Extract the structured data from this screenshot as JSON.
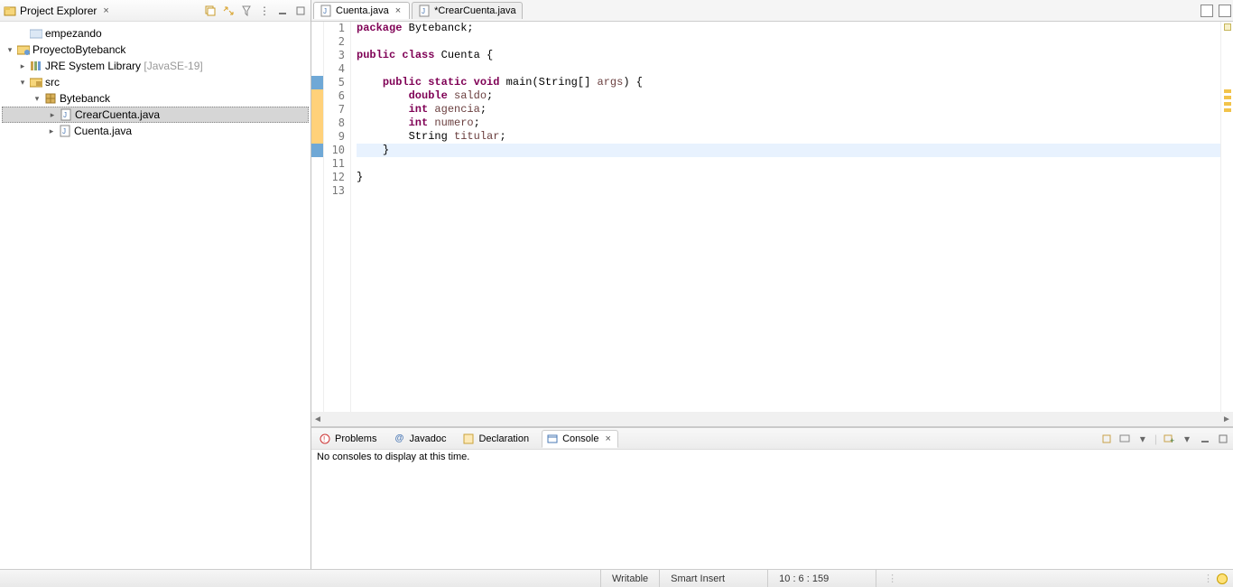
{
  "project_explorer": {
    "title": "Project Explorer",
    "tree": {
      "empezando": "empezando",
      "proyecto": "ProyectoBytebanck",
      "jre": "JRE System Library",
      "jre_qualifier": "[JavaSE-19]",
      "src": "src",
      "pkg": "Bytebanck",
      "crear": "CrearCuenta.java",
      "cuenta": "Cuenta.java"
    }
  },
  "editor": {
    "tabs": {
      "active": "Cuenta.java",
      "second": "*CrearCuenta.java"
    },
    "code": {
      "l1_kw": "package",
      "l1_rest": " Bytebanck;",
      "l3a": "public",
      "l3b": "class",
      "l3c": " Cuenta {",
      "l5a": "public",
      "l5b": "static",
      "l5c": "void",
      "l5d": " main(String[] ",
      "l5e": "args",
      "l5f": ") {",
      "l6a": "double",
      "l6b": "saldo",
      "l6c": ";",
      "l7a": "int",
      "l7b": "agencia",
      "l7c": ";",
      "l8a": "int",
      "l8b": "numero",
      "l8c": ";",
      "l9a": "String ",
      "l9b": "titular",
      "l9c": ";",
      "l10": "}",
      "l12": "}"
    },
    "lines": [
      "1",
      "2",
      "3",
      "4",
      "5",
      "6",
      "7",
      "8",
      "9",
      "10",
      "11",
      "12",
      "13"
    ]
  },
  "bottom": {
    "problems": "Problems",
    "javadoc": "Javadoc",
    "declaration": "Declaration",
    "console": "Console",
    "msg": "No consoles to display at this time."
  },
  "status": {
    "writable": "Writable",
    "insert": "Smart Insert",
    "pos": "10 : 6 : 159"
  }
}
